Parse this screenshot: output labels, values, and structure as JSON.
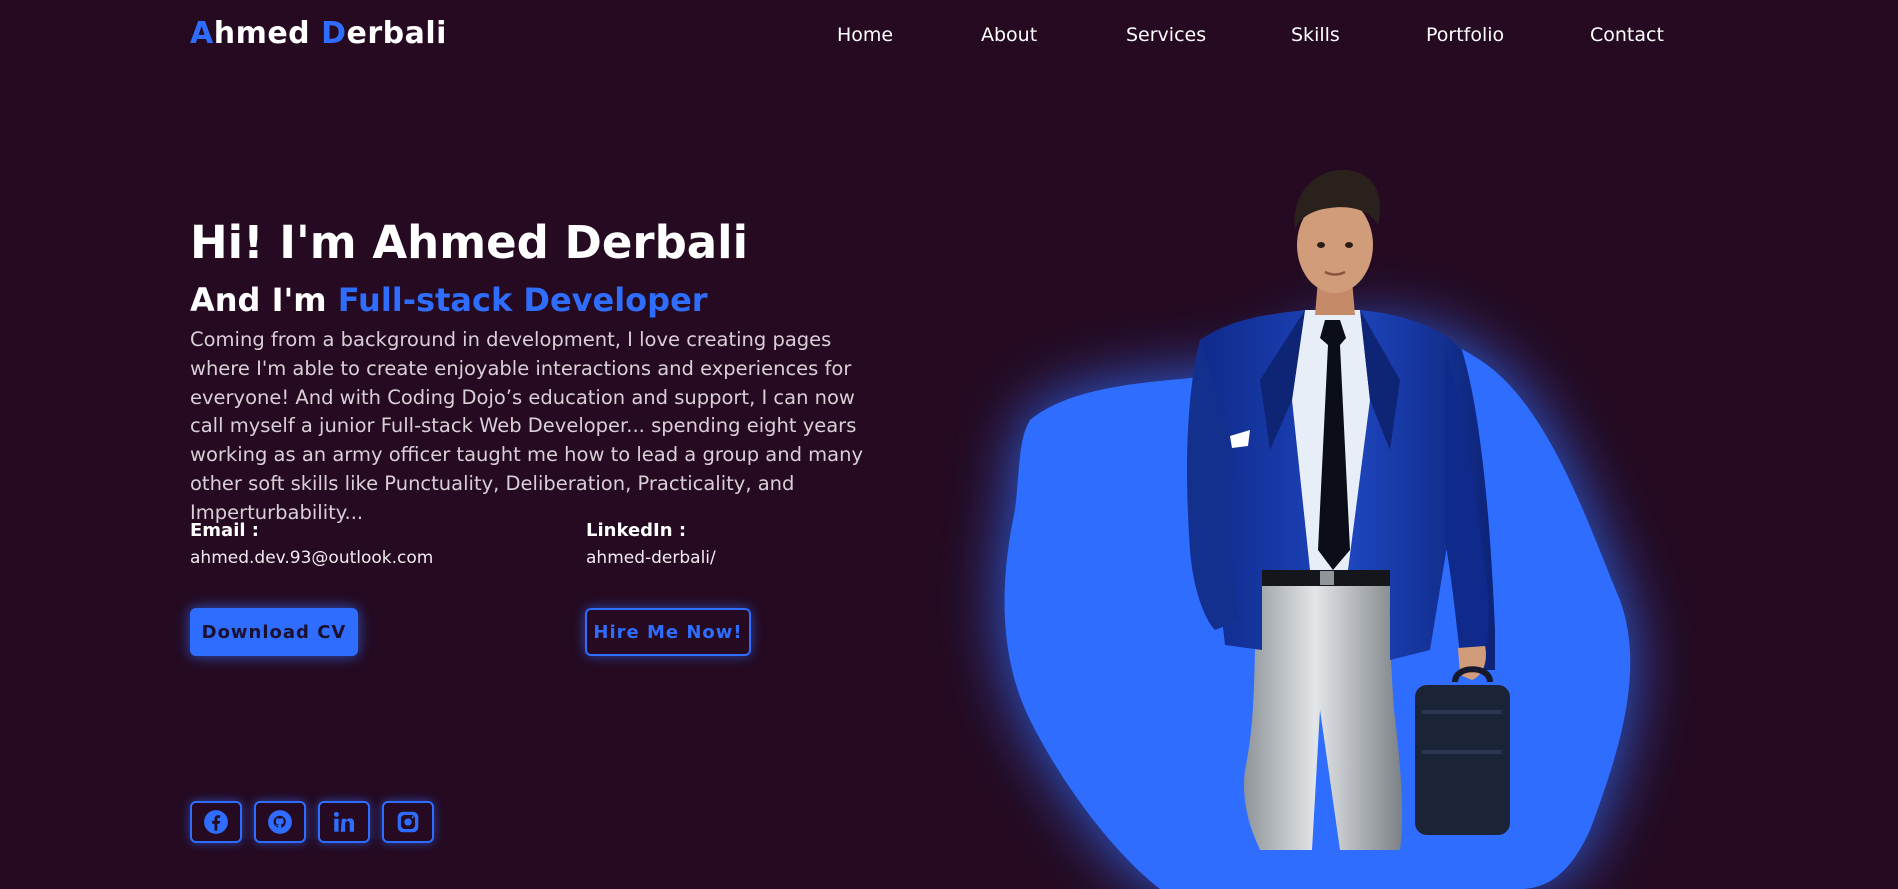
{
  "brand": {
    "first_initial": "A",
    "first_rest": "hmed",
    "last_initial": "D",
    "last_rest": "erbali",
    "accent_color": "#2f6dff"
  },
  "nav": {
    "items": [
      {
        "label": "Home"
      },
      {
        "label": "About"
      },
      {
        "label": "Services"
      },
      {
        "label": "Skills"
      },
      {
        "label": "Portfolio"
      },
      {
        "label": "Contact"
      }
    ]
  },
  "hero": {
    "title": "Hi! I'm Ahmed Derbali",
    "subtitle_prefix": "And I'm",
    "subtitle_role": "Full-stack Developer",
    "intro": "Coming from a background in development, I love creating pages where I'm able to create enjoyable interactions and experiences for everyone! And with Coding Dojo’s education and support, I can now call myself a junior Full-stack Web Developer... spending eight years working as an army officer taught me how to lead a group and many other soft skills like Punctuality, Deliberation, Practicality, and Imperturbability..."
  },
  "contact_info": {
    "email_label": "Email :",
    "email_value": "ahmed.dev.93@outlook.com",
    "linkedin_label": "LinkedIn :",
    "linkedin_value": "ahmed-derbali/"
  },
  "actions": {
    "download_cv": "Download CV",
    "hire_me": "Hire Me Now!"
  },
  "socials": [
    {
      "icon": "facebook-icon"
    },
    {
      "icon": "github-icon"
    },
    {
      "icon": "linkedin-icon"
    },
    {
      "icon": "instagram-icon"
    }
  ],
  "colors": {
    "background": "#250a21",
    "accent": "#2f6dff",
    "text": "#ffffff"
  }
}
